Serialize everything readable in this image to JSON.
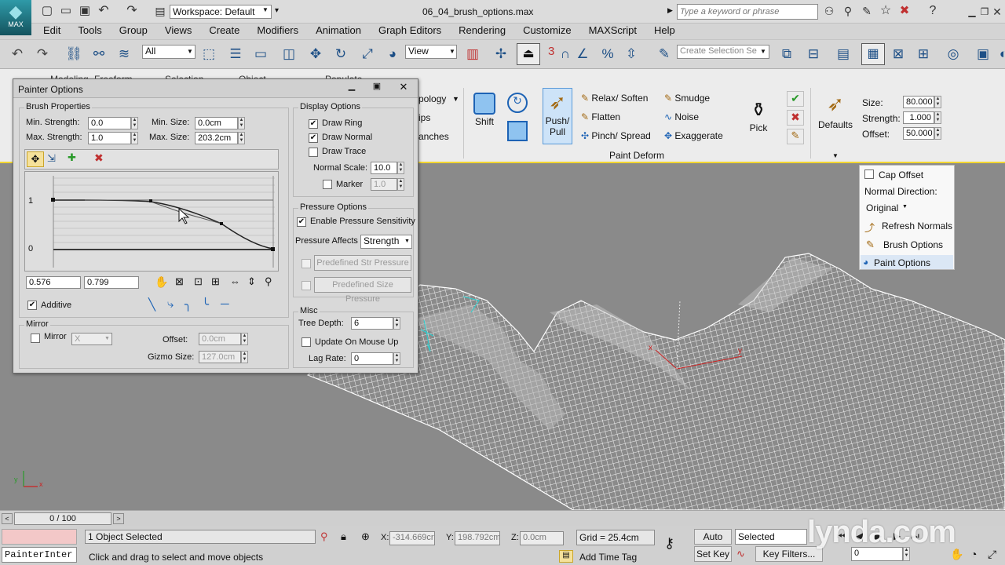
{
  "title_bar": {
    "app_logo": "MAX",
    "workspace": "Workspace: Default",
    "file_name": "06_04_brush_options.max",
    "search_placeholder": "Type a keyword or phrase"
  },
  "menu": [
    "Edit",
    "Tools",
    "Group",
    "Views",
    "Create",
    "Modifiers",
    "Animation",
    "Graph Editors",
    "Rendering",
    "Customize",
    "MAXScript",
    "Help"
  ],
  "toolbar": {
    "filter_value": "All",
    "view_value": "View",
    "snap_label": "3",
    "selection_set_placeholder": "Create Selection Se"
  },
  "ribbon": {
    "tabs": [
      "Modeling",
      "Freeform",
      "Selection",
      "Object Paint",
      "Populate"
    ],
    "left_cut": [
      "pology",
      "ips",
      "anches"
    ],
    "shift_label": "Shift",
    "push_pull_label": "Push/ Pull",
    "tools": [
      "Relax/ Soften",
      "Smudge",
      "Flatten",
      "Noise",
      "Pinch/ Spread",
      "Exaggerate"
    ],
    "pick_label": "Pick",
    "defaults_label": "Defaults",
    "group_label": "Paint Deform",
    "size_label": "Size:",
    "size_value": "80.000",
    "strength_label": "Strength:",
    "strength_value": "1.000",
    "offset_label": "Offset:",
    "offset_value": "50.000"
  },
  "dropdown": {
    "cap_offset": "Cap Offset",
    "normal_direction": "Normal Direction:",
    "original": "Original",
    "refresh_normals": "Refresh Normals",
    "brush_options": "Brush Options",
    "paint_options": "Paint Options"
  },
  "painter": {
    "title": "Painter Options",
    "brush_properties": "Brush Properties",
    "min_strength_label": "Min. Strength:",
    "min_strength": "0.0",
    "max_strength_label": "Max. Strength:",
    "max_strength": "1.0",
    "min_size_label": "Min. Size:",
    "min_size": "0.0cm",
    "max_size_label": "Max. Size:",
    "max_size": "203.2cm",
    "graph_y1": "1",
    "graph_y0": "0",
    "point_x": "0.576",
    "point_y": "0.799",
    "additive": "Additive",
    "mirror_group": "Mirror",
    "mirror_label": "Mirror",
    "mirror_axis": "X",
    "offset_label": "Offset:",
    "offset_value": "0.0cm",
    "gizmo_label": "Gizmo Size:",
    "gizmo_value": "127.0cm",
    "display_options": "Display Options",
    "draw_ring": "Draw Ring",
    "draw_normal": "Draw Normal",
    "draw_trace": "Draw Trace",
    "normal_scale_label": "Normal Scale:",
    "normal_scale": "10.0",
    "marker_label": "Marker",
    "marker_value": "1.0",
    "pressure_options": "Pressure Options",
    "enable_pressure": "Enable Pressure Sensitivity",
    "pressure_affects_label": "Pressure Affects",
    "pressure_affects": "Strength",
    "predefined_str": "Predefined Str Pressure",
    "predefined_size": "Predefined Size Pressure",
    "misc": "Misc",
    "tree_depth_label": "Tree Depth:",
    "tree_depth": "6",
    "update_on_mouse_up": "Update On Mouse Up",
    "lag_rate_label": "Lag Rate:",
    "lag_rate": "0"
  },
  "timeline": {
    "frame": "0 / 100"
  },
  "status": {
    "script_listener": "PainterInter",
    "selection": "1 Object Selected",
    "prompt": "Click and drag to select and move objects",
    "x_label": "X:",
    "x_value": "-314.669cr",
    "y_label": "Y:",
    "y_value": "198.792cm",
    "z_label": "Z:",
    "z_value": "0.0cm",
    "grid": "Grid = 25.4cm",
    "add_time_tag": "Add Time Tag",
    "auto_key": "Auto Key",
    "set_key": "Set Key",
    "key_mode": "Selected",
    "key_filters": "Key Filters...",
    "current_frame": "0"
  },
  "watermark": "lynda.com",
  "colors": {
    "viewport": "#8a8a8a",
    "ribbon": "#ececec",
    "dialog": "#d9d9d9",
    "selected_outline": "#f2d630",
    "accent_blue": "#1d63b5"
  }
}
